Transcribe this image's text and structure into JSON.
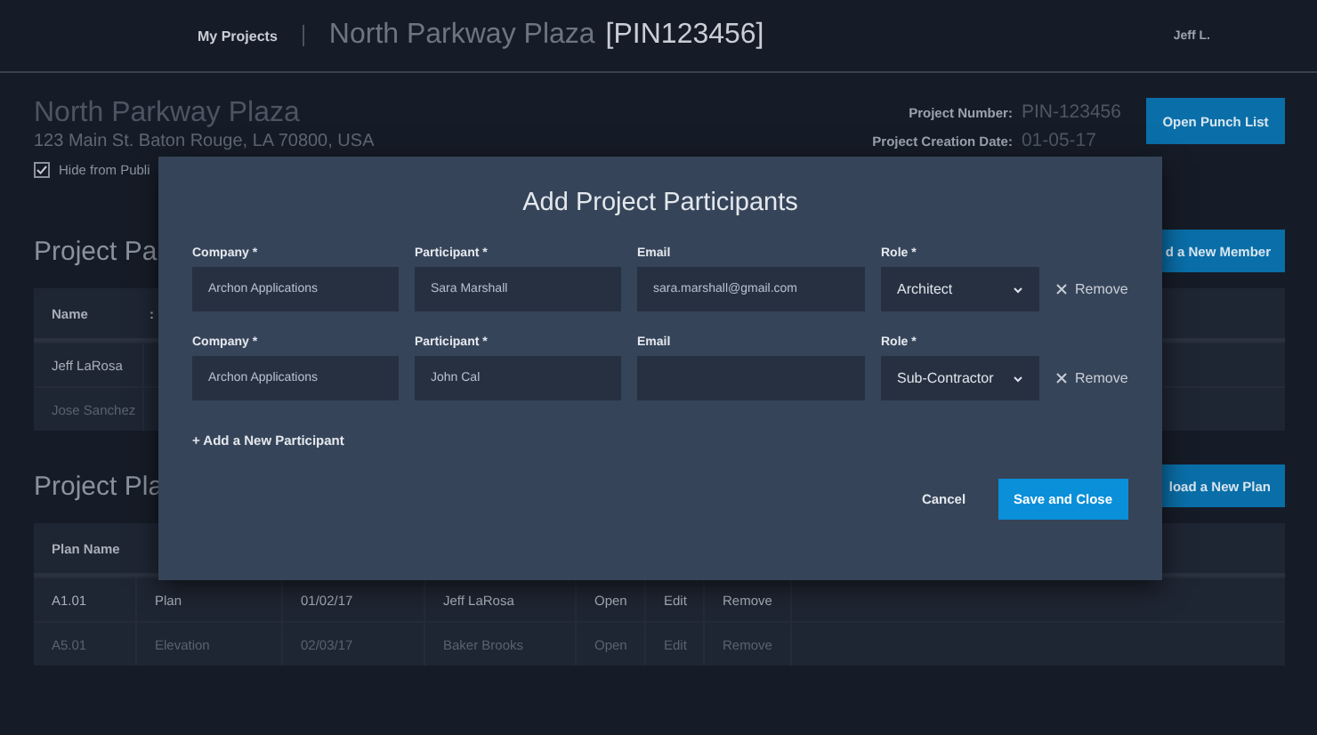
{
  "header": {
    "nav_link": "My Projects",
    "project_title": "North Parkway Plaza",
    "project_pin": "[PIN123456]",
    "user": "Jeff L."
  },
  "project": {
    "name": "North Parkway Plaza",
    "address": "123 Main St. Baton Rouge, LA 70800, USA",
    "hide_from_public": {
      "label": "Hide from Publi",
      "checked": true
    },
    "info": [
      {
        "label": "Project Number:",
        "value": "PIN-123456"
      },
      {
        "label": "Project Creation Date:",
        "value": "01-05-17"
      }
    ],
    "button": "Open Punch List"
  },
  "participants_section": {
    "title": "Project Pa",
    "button": "d a New Member",
    "table": {
      "columns": [
        "Name",
        ":"
      ],
      "rows": [
        {
          "cells": [
            "Jeff LaRosa"
          ],
          "muted": false
        },
        {
          "cells": [
            "Jose Sanchez"
          ],
          "muted": true
        }
      ]
    }
  },
  "plans_section": {
    "title": "Project Pla",
    "button": "load a New Plan",
    "table": {
      "columns": [
        "Plan Name"
      ],
      "rows": [
        {
          "cells": [
            "A1.01",
            "Plan",
            "01/02/17",
            "Jeff LaRosa",
            "Open",
            "Edit",
            "Remove"
          ],
          "muted": false
        },
        {
          "cells": [
            "A5.01",
            "Elevation",
            "02/03/17",
            "Baker Brooks",
            "Open",
            "Edit",
            "Remove"
          ],
          "muted": true
        }
      ]
    }
  },
  "modal": {
    "title": "Add Project Participants",
    "rows": [
      {
        "company": {
          "label": "Company *",
          "value": "Archon Applications"
        },
        "participant": {
          "label": "Participant *",
          "value": "Sara Marshall"
        },
        "email": {
          "label": "Email",
          "value": "sara.marshall@gmail.com"
        },
        "role": {
          "label": "Role *",
          "value": "Architect"
        },
        "remove": "Remove"
      },
      {
        "company": {
          "label": "Company *",
          "value": "Archon Applications"
        },
        "participant": {
          "label": "Participant *",
          "value": "John Cal"
        },
        "email": {
          "label": "Email"
        },
        "role": {
          "label": "Role *",
          "value": "Sub-Contractor"
        },
        "remove": "Remove"
      }
    ],
    "add_link": "+ Add a New Participant",
    "cancel": "Cancel",
    "save": "Save and Close"
  }
}
